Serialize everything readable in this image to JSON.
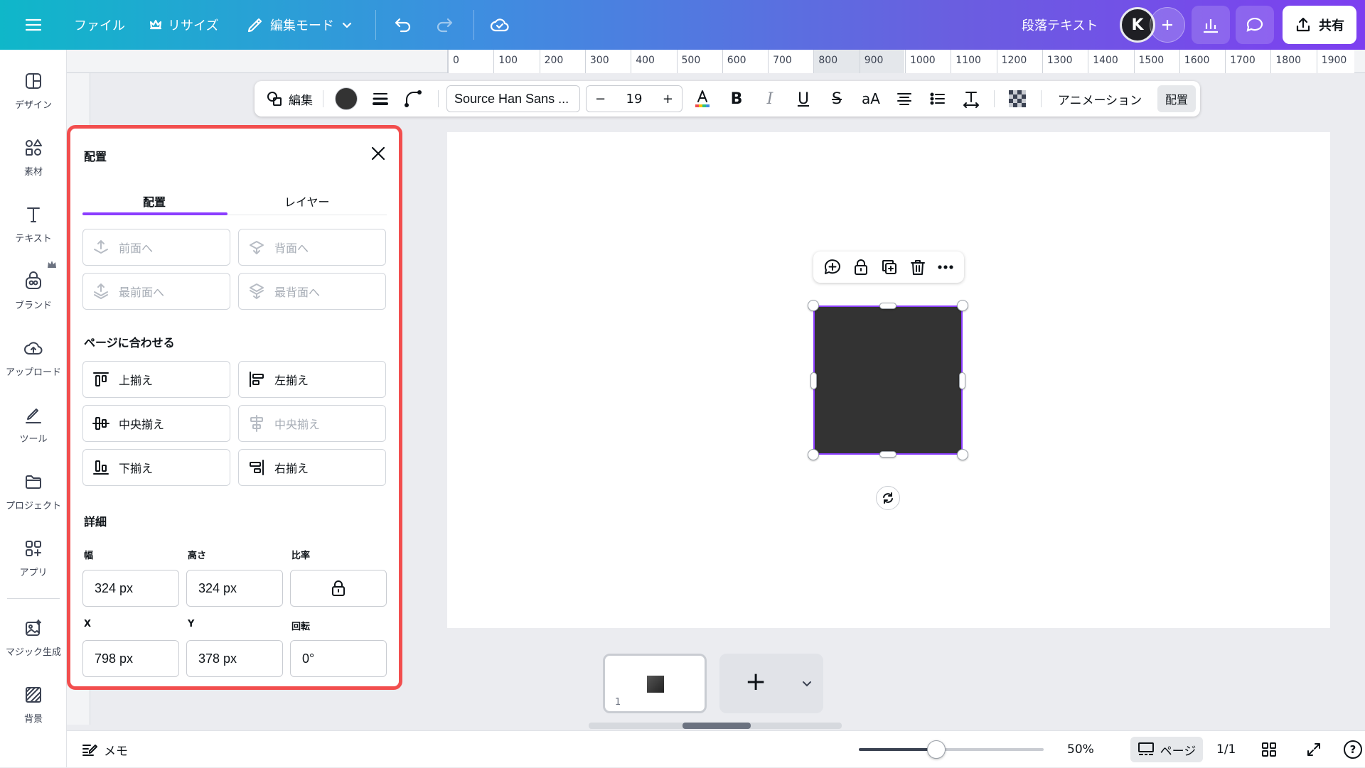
{
  "topbar": {
    "file_label": "ファイル",
    "resize_label": "リサイズ",
    "edit_mode_label": "編集モード",
    "element_name": "段落テキスト",
    "avatar_letter": "K",
    "share_label": "共有",
    "gradient": [
      "#0fb7c9",
      "#7d3ff0"
    ]
  },
  "sidebar": {
    "items": [
      {
        "label": "デザイン",
        "icon": "design-icon"
      },
      {
        "label": "素材",
        "icon": "elements-icon"
      },
      {
        "label": "テキスト",
        "icon": "text-icon"
      },
      {
        "label": "ブランド",
        "icon": "brand-icon"
      },
      {
        "label": "アップロード",
        "icon": "upload-icon"
      },
      {
        "label": "ツール",
        "icon": "tools-icon"
      },
      {
        "label": "プロジェクト",
        "icon": "folder-icon"
      },
      {
        "label": "アプリ",
        "icon": "apps-icon"
      },
      {
        "label": "マジック生成",
        "icon": "magic-icon"
      },
      {
        "label": "背景",
        "icon": "background-icon"
      }
    ]
  },
  "ruler": {
    "ticks": [
      "0",
      "100",
      "200",
      "300",
      "400",
      "500",
      "600",
      "700",
      "800",
      "900",
      "1000",
      "1100",
      "1200",
      "1300",
      "1400",
      "1500",
      "1600",
      "1700",
      "1800",
      "1900"
    ]
  },
  "toolbar": {
    "edit_label": "編集",
    "font_name": "Source Han Sans ...",
    "font_size": "19",
    "minus": "−",
    "plus": "+",
    "case_label": "aA",
    "animation_label": "アニメーション",
    "arrange_label": "配置",
    "bold": "B",
    "italic": "I",
    "underline": "U",
    "strike": "S"
  },
  "panel": {
    "title": "配置",
    "tabs": [
      "配置",
      "レイヤー"
    ],
    "order_buttons": [
      "前面へ",
      "背面へ",
      "最前面へ",
      "最背面へ"
    ],
    "align_section": "ページに合わせる",
    "align_buttons": [
      "上揃え",
      "左揃え",
      "中央揃え",
      "中央揃え",
      "下揃え",
      "右揃え"
    ],
    "detail_section": "詳細",
    "labels": {
      "width": "幅",
      "height": "高さ",
      "ratio": "比率",
      "x": "X",
      "y": "Y",
      "rotation": "回転"
    },
    "values": {
      "width": "324 px",
      "height": "324 px",
      "x": "798 px",
      "y": "378 px",
      "rotation": "0°"
    },
    "accent": "#8b3dff",
    "highlight_border": "#f24e4e"
  },
  "canvas": {
    "shape_color": "#333333",
    "selection_color": "#8b3dff"
  },
  "pages": {
    "thumb_number": "1",
    "add": "+"
  },
  "status": {
    "notes_label": "メモ",
    "zoom": "50%",
    "zoom_fraction": 0.42,
    "pages_label": "ページ",
    "page_count": "1/1",
    "help": "?"
  }
}
